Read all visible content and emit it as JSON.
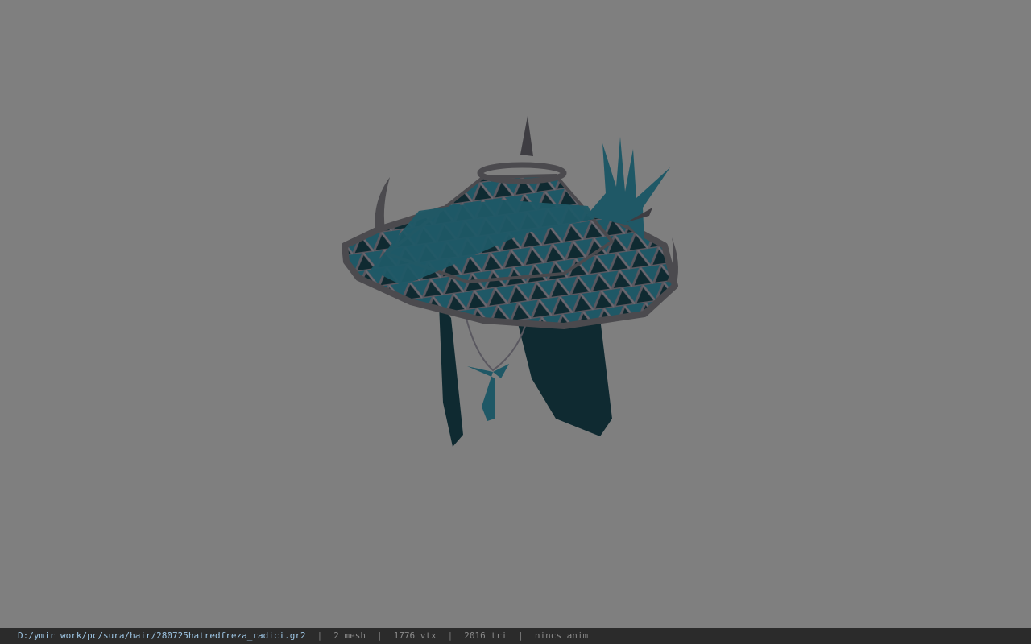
{
  "viewer": {
    "background_color": "#7f7f7f",
    "model_name": "hat-with-hair-model",
    "colors": {
      "teal": "#1f5866",
      "teal_light": "#2a6c7a",
      "frame": "#4b4a4e",
      "frame_light": "#6a6870",
      "hair": "#0f2a31",
      "dark": "#101c20"
    }
  },
  "status_bar": {
    "file_path": "D:/ymir work/pc/sura/hair/280725hatredfreza_radici.gr2",
    "separator": "|",
    "mesh_count": "2 mesh",
    "vertex_count": "1776 vtx",
    "triangle_count": "2016 tri",
    "animation_status": "nincs anim"
  }
}
